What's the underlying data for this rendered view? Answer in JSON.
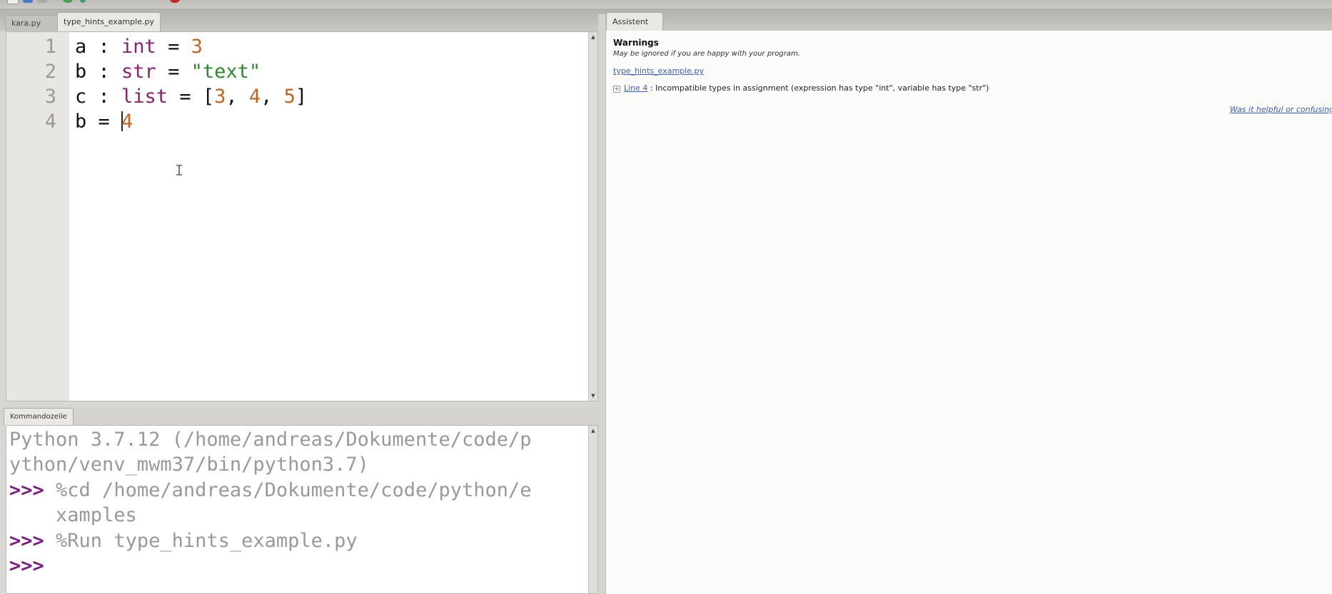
{
  "editor": {
    "tabs": [
      {
        "label": "kara.py",
        "active": false
      },
      {
        "label": "type_hints_example.py",
        "active": true
      }
    ],
    "line_numbers": [
      "1",
      "2",
      "3",
      "4"
    ],
    "lines": [
      [
        {
          "t": "a : ",
          "c": ""
        },
        {
          "t": "int",
          "c": "kw"
        },
        {
          "t": " = ",
          "c": ""
        },
        {
          "t": "3",
          "c": "num"
        }
      ],
      [
        {
          "t": "b : ",
          "c": ""
        },
        {
          "t": "str",
          "c": "kw"
        },
        {
          "t": " = ",
          "c": ""
        },
        {
          "t": "\"text\"",
          "c": "str"
        }
      ],
      [
        {
          "t": "c : ",
          "c": ""
        },
        {
          "t": "list",
          "c": "kw"
        },
        {
          "t": " = [",
          "c": ""
        },
        {
          "t": "3",
          "c": "num"
        },
        {
          "t": ", ",
          "c": ""
        },
        {
          "t": "4",
          "c": "num"
        },
        {
          "t": ", ",
          "c": ""
        },
        {
          "t": "5",
          "c": "num"
        },
        {
          "t": "]",
          "c": ""
        }
      ],
      [
        {
          "t": "b = ",
          "c": ""
        },
        {
          "t": "|",
          "c": "caret"
        },
        {
          "t": "4",
          "c": "num"
        }
      ]
    ],
    "mouse_cursor_icon": "I"
  },
  "shell": {
    "tab_label": "Kommandozeile",
    "lines": [
      {
        "prompt": "",
        "text": "Python 3.7.12 (/home/andreas/Dokumente/code/p"
      },
      {
        "prompt": "",
        "text": "ython/venv_mwm37/bin/python3.7)"
      },
      {
        "prompt": ">>>",
        "text": " %cd /home/andreas/Dokumente/code/python/e"
      },
      {
        "prompt": "",
        "text": "    xamples"
      },
      {
        "prompt": ">>>",
        "text": " %Run type_hints_example.py"
      },
      {
        "prompt": ">>>",
        "text": ""
      }
    ]
  },
  "assistant": {
    "tab_label": "Assistent",
    "title": "Warnings",
    "subtitle": "May be ignored if you are happy with your program.",
    "file_link": "type_hints_example.py",
    "warning": {
      "expander": "+",
      "line_link": "Line 4",
      "message": " : Incompatible types in assignment (expression has type \"int\", variable has type \"str\")"
    },
    "feedback_link": "Was it helpful or confusing?"
  }
}
